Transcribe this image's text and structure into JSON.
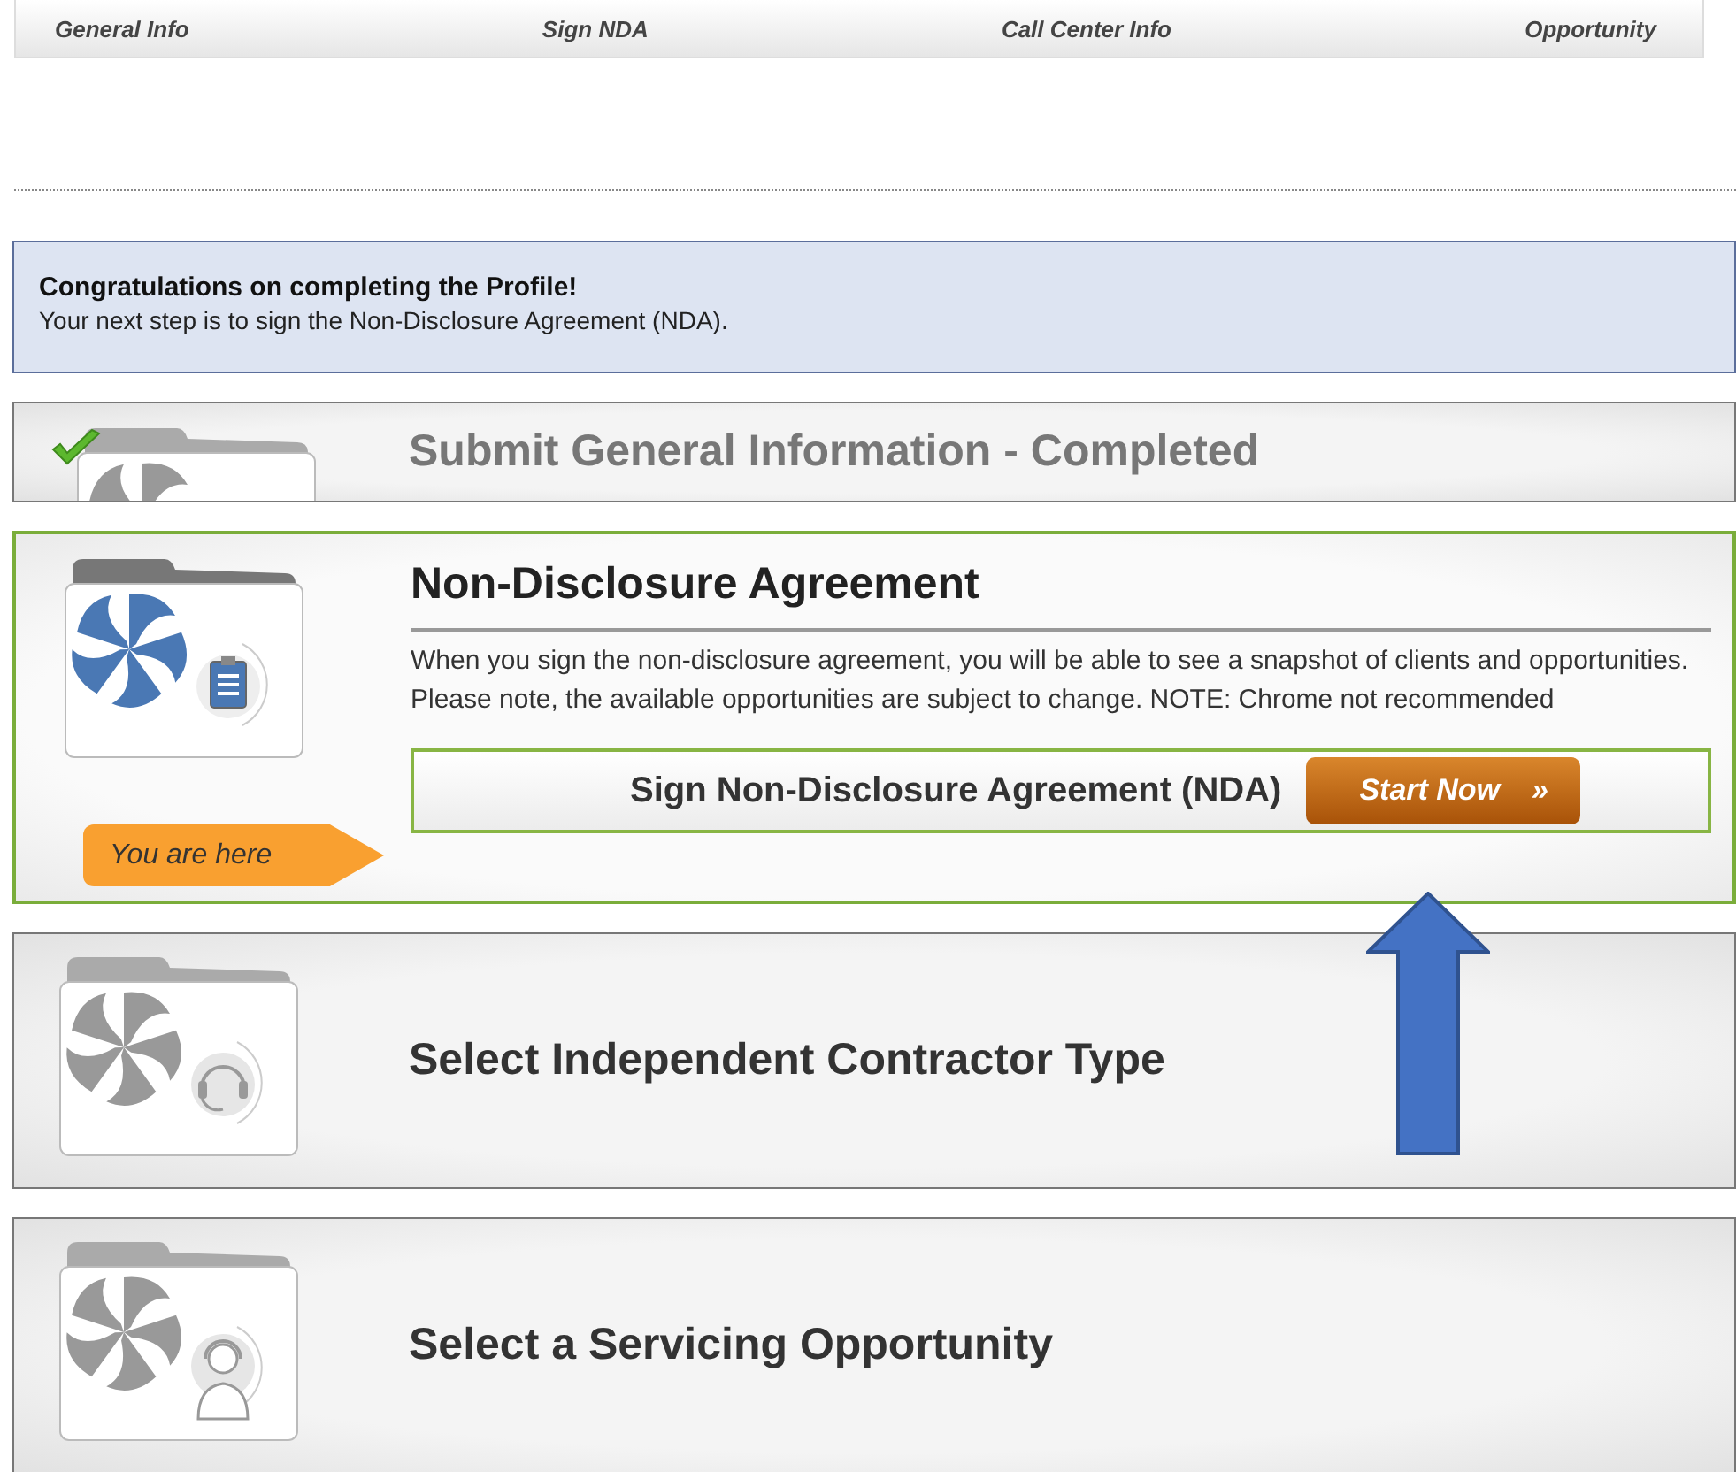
{
  "progress_tabs": [
    {
      "label": "General Info"
    },
    {
      "label": "Sign NDA"
    },
    {
      "label": "Call Center Info"
    },
    {
      "label": "Opportunity"
    }
  ],
  "notice": {
    "title": "Congratulations on completing the Profile!",
    "message": "Your next step is to sign the Non-Disclosure Agreement (NDA)."
  },
  "steps": [
    {
      "kind": "completed",
      "title": "Submit General Information - Completed"
    },
    {
      "kind": "current",
      "title": "Non-Disclosure Agreement",
      "description": "When you sign the non-disclosure agreement, you will be able to see a snapshot of clients and opportunities. Please note, the available opportunities are subject to change. NOTE: Chrome not recommended",
      "marker": "You are here",
      "action": "Sign Non-Disclosure Agreement (NDA)",
      "button": "Start Now",
      "button_icon": "»"
    },
    {
      "kind": "pending",
      "title": "Select Independent Contractor Type"
    },
    {
      "kind": "pending",
      "title": "Select a Servicing Opportunity"
    }
  ]
}
